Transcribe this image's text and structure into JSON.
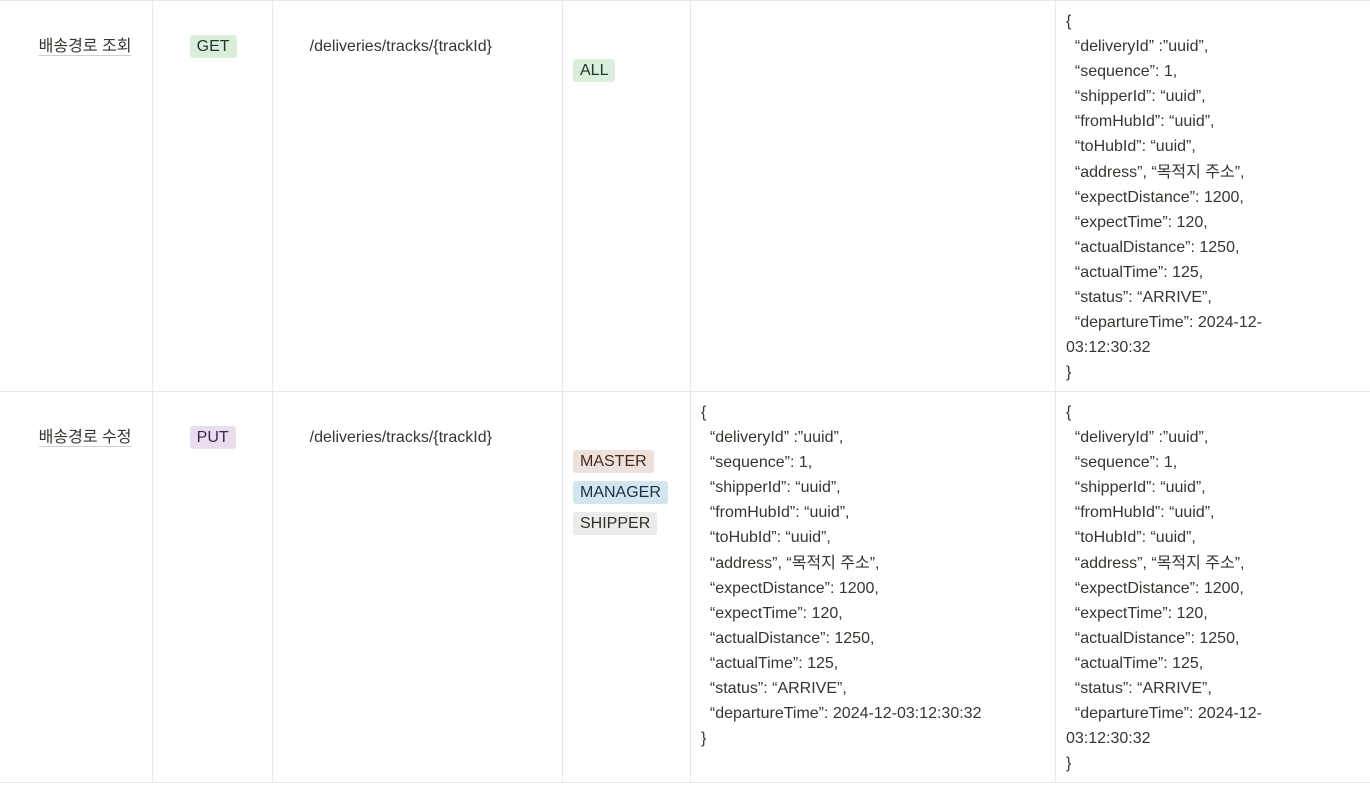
{
  "rows": [
    {
      "title": "배송경로 조회",
      "method": "GET",
      "url": "/deliveries/tracks/{trackId}",
      "roles": [
        "ALL"
      ],
      "request": "",
      "response": "{\n  “deliveryId” :”uuid”,\n  “sequence”: 1,\n  “shipperId”: “uuid”,\n  “fromHubId”: “uuid”,\n  “toHubId”: “uuid”,\n  “address”, “목적지 주소”,\n  “expectDistance”: 1200,\n  “expectTime”: 120,\n  “actualDistance”: 1250,\n  “actualTime”: 125,\n  “status”: “ARRIVE”,\n  “departureTime”: 2024-12-\n03:12:30:32\n}"
    },
    {
      "title": "배송경로 수정",
      "method": "PUT",
      "url": "/deliveries/tracks/{trackId}",
      "roles": [
        "MASTER",
        "MANAGER",
        "SHIPPER"
      ],
      "request": "{\n  “deliveryId” :”uuid”,\n  “sequence”: 1,\n  “shipperId”: “uuid”,\n  “fromHubId”: “uuid”,\n  “toHubId”: “uuid”,\n  “address”, “목적지 주소”,\n  “expectDistance”: 1200,\n  “expectTime”: 120,\n  “actualDistance”: 1250,\n  “actualTime”: 125,\n  “status”: “ARRIVE”,\n  “departureTime”: 2024-12-03:12:30:32\n}",
      "response": "{\n  “deliveryId” :”uuid”,\n  “sequence”: 1,\n  “shipperId”: “uuid”,\n  “fromHubId”: “uuid”,\n  “toHubId”: “uuid”,\n  “address”, “목적지 주소”,\n  “expectDistance”: 1200,\n  “expectTime”: 120,\n  “actualDistance”: 1250,\n  “actualTime”: 125,\n  “status”: “ARRIVE”,\n  “departureTime”: 2024-12-\n03:12:30:32\n}"
    }
  ],
  "colors": {
    "get": "#dbeddb",
    "put": "#e8deee",
    "master": "#eee0da",
    "manager": "#d3e5ef",
    "shipper": "#ebebea",
    "border": "#e9e9e7"
  }
}
